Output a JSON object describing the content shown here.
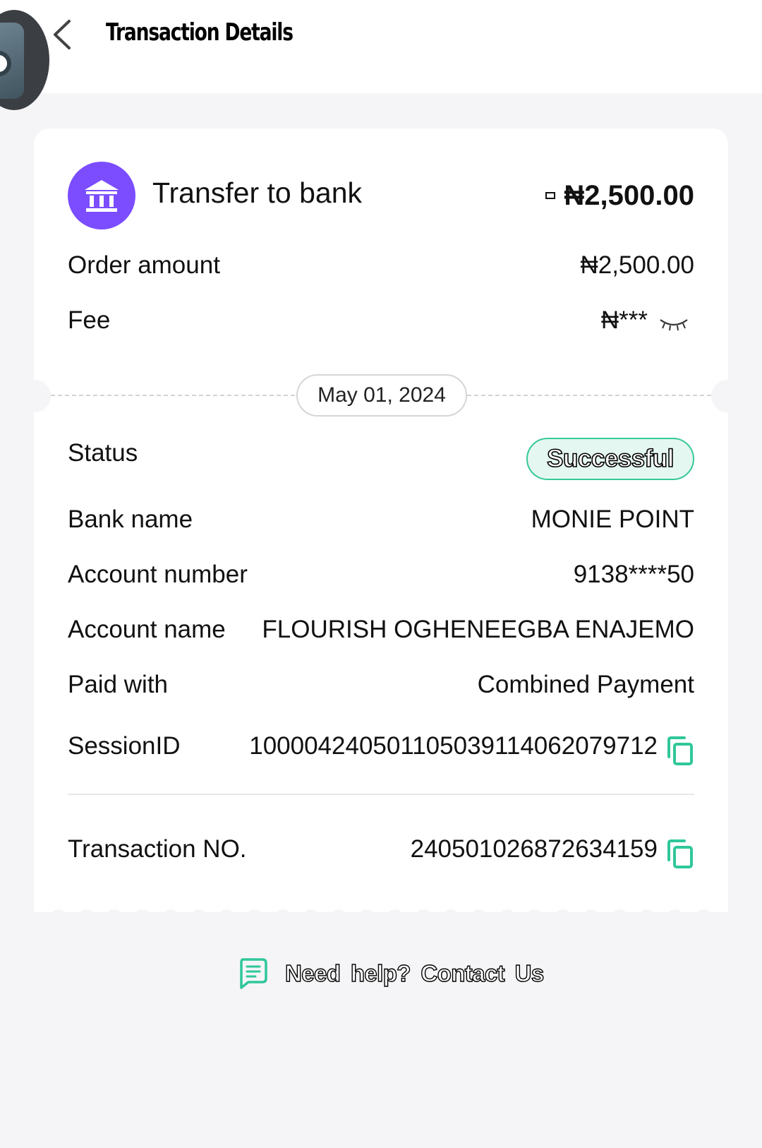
{
  "header": {
    "title": "Transaction Details",
    "back_icon": "chevron-left-icon"
  },
  "summary": {
    "title": "Transfer to bank",
    "amount": "₦2,500.00",
    "icon": "bank-icon",
    "icon_color": "#7b4dff"
  },
  "details_top": [
    {
      "label": "Order amount",
      "value": "₦2,500.00"
    },
    {
      "label": "Fee",
      "value": "₦***"
    }
  ],
  "date": "May 01, 2024",
  "status": {
    "label": "Status",
    "value": "Successful",
    "accent": "#37c89b"
  },
  "details": [
    {
      "label": "Bank name",
      "value": "MONIE POINT"
    },
    {
      "label": "Account number",
      "value": "9138****50"
    },
    {
      "label": "Account name",
      "value": "FLOURISH OGHENEEGBA ENAJEMO"
    },
    {
      "label": "Paid with",
      "value": "Combined Payment"
    }
  ],
  "session": {
    "label": "SessionID",
    "value": "100004240501105039114062079712"
  },
  "transaction": {
    "label": "Transaction NO.",
    "value": "240501026872634159"
  },
  "help": {
    "text": "Need help?  Contact Us",
    "icon": "chat-icon"
  }
}
